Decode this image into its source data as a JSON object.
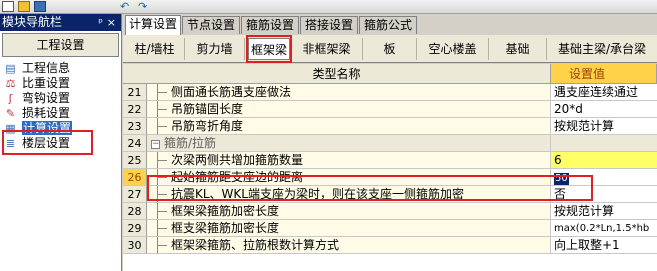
{
  "nav": {
    "title": "模块导航栏",
    "pin_glyph": "ᵖ",
    "close_glyph": "×",
    "header": "工程设置",
    "items": [
      {
        "label": "工程信息",
        "icon": "document-info-icon"
      },
      {
        "label": "比重设置",
        "icon": "weight-icon"
      },
      {
        "label": "弯钩设置",
        "icon": "hook-icon"
      },
      {
        "label": "损耗设置",
        "icon": "loss-icon"
      },
      {
        "label": "计算设置",
        "icon": "calculator-icon",
        "selected": true
      },
      {
        "label": "楼层设置",
        "icon": "floor-icon"
      }
    ]
  },
  "main_tabs": [
    "计算设置",
    "节点设置",
    "箍筋设置",
    "搭接设置",
    "箍筋公式"
  ],
  "sub_tabs": [
    "柱/墙柱",
    "剪力墙",
    "框架梁",
    "非框架梁",
    "板",
    "空心楼盖",
    "基础",
    "基础主梁/承台梁"
  ],
  "grid": {
    "col_name": "类型名称",
    "col_value": "设置值",
    "rows": [
      {
        "num": "21",
        "name": "侧面通长筋遇支座做法",
        "value": "遇支座连续通过"
      },
      {
        "num": "22",
        "name": "吊筋锚固长度",
        "value": "20*d"
      },
      {
        "num": "23",
        "name": "吊筋弯折角度",
        "value": "按规范计算"
      },
      {
        "num": "24",
        "name": "箍筋/拉筋",
        "value": "",
        "group": true
      },
      {
        "num": "25",
        "name": "次梁两侧共增加箍筋数量",
        "value": "6",
        "highlight": true
      },
      {
        "num": "26",
        "name": "起始箍筋距支座边的距离",
        "value": "50",
        "current": true
      },
      {
        "num": "27",
        "name": "抗震KL、WKL端支座为梁时，则在该支座一侧箍筋加密",
        "value": "否"
      },
      {
        "num": "28",
        "name": "框架梁箍筋加密长度",
        "value": "按规范计算"
      },
      {
        "num": "29",
        "name": "框支梁箍筋加密长度",
        "value": "max(0.2*Ln,1.5*hb"
      },
      {
        "num": "30",
        "name": "框架梁箍筋、拉筋根数计算方式",
        "value": "向上取整+1"
      }
    ]
  },
  "colors": {
    "highlight_red": "#e02020",
    "header_yellow": "#ffd24a",
    "nav_title_blue": "#0a246a"
  }
}
